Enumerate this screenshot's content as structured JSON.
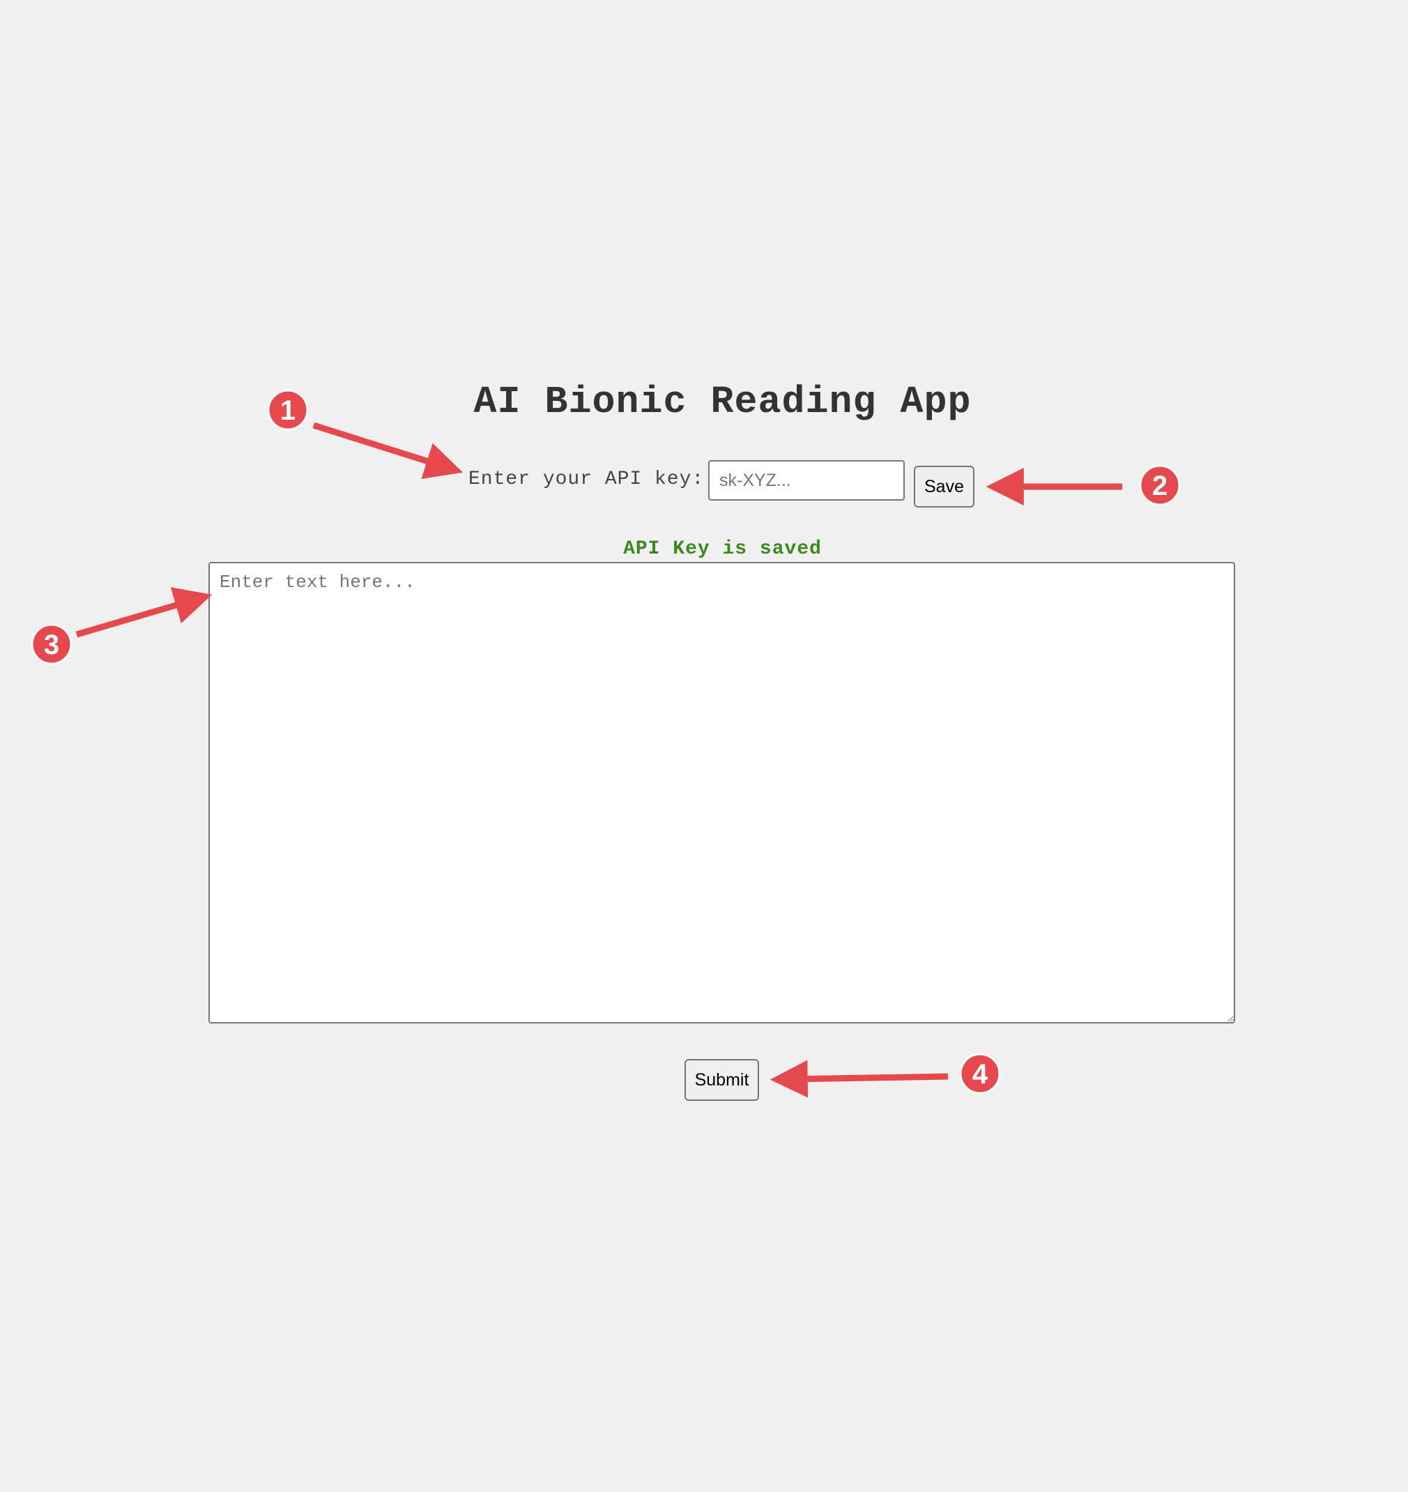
{
  "app": {
    "title": "AI Bionic Reading App"
  },
  "api_key": {
    "label": "Enter your API key:",
    "placeholder": "sk-XYZ...",
    "value": "",
    "save_label": "Save",
    "status": "API Key is saved"
  },
  "editor": {
    "placeholder": "Enter text here...",
    "value": ""
  },
  "submit": {
    "label": "Submit"
  },
  "annotations": {
    "badges": [
      "1",
      "2",
      "3",
      "4"
    ],
    "color": "#e5484d"
  },
  "colors": {
    "background": "#f0f0f0",
    "title": "#333333",
    "status": "#3c8a1e"
  }
}
